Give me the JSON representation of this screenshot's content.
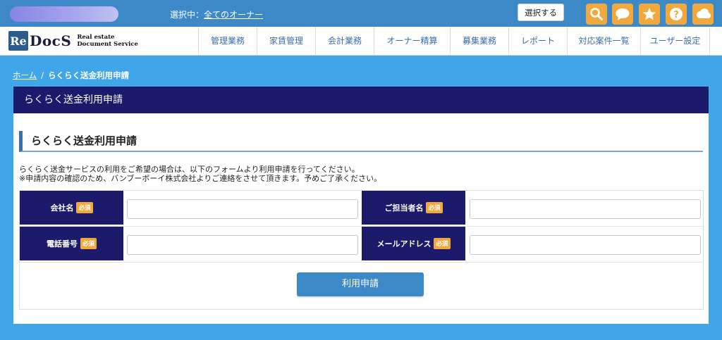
{
  "topbar": {
    "selecting_label": "選択中：",
    "owner_link": "全てのオーナー",
    "select_button": "選択する",
    "icons": [
      "search-icon",
      "chat-icon",
      "star-icon",
      "help-icon",
      "cloud-icon"
    ]
  },
  "logo": {
    "re": "Re",
    "docs": "DocS",
    "sub_line1": "Real estate",
    "sub_line2": "Document Service"
  },
  "nav": {
    "items": [
      "管理業務",
      "家賃管理",
      "会計業務",
      "オーナー精算",
      "募集業務",
      "レポート",
      "対応案件一覧",
      "ユーザー設定"
    ]
  },
  "breadcrumb": {
    "home": "ホーム",
    "separator": "/",
    "current": "らくらく送金利用申請"
  },
  "panel": {
    "header": "らくらく送金利用申請",
    "section_title": "らくらく送金利用申請",
    "desc_line1": "らくらく送金サービスの利用をご希望の場合は、以下のフォームより利用申請を行ってください。",
    "desc_line2": "※申請内容の確認のため、バンブーボーイ株式会社よりご連絡をさせて頂きます。予めご了承ください。"
  },
  "form": {
    "required_badge": "必須",
    "company_label": "会社名",
    "contact_label": "ご担当者名",
    "phone_label": "電話番号",
    "email_label": "メールアドレス",
    "company_value": "",
    "contact_value": "",
    "phone_value": "",
    "email_value": "",
    "submit_label": "利用申請"
  },
  "colors": {
    "page_bg": "#40a6e8",
    "topbar": "#3d89c8",
    "navy": "#1b1a6b",
    "accent_orange": "#f1a93e",
    "nav_text": "#3b6ea8"
  }
}
